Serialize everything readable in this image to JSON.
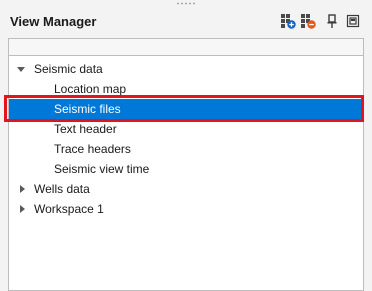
{
  "panel": {
    "title": "View Manager",
    "toolbar": [
      {
        "name": "add-view-icon"
      },
      {
        "name": "remove-view-icon"
      },
      {
        "name": "pin-icon"
      },
      {
        "name": "float-window-icon"
      }
    ]
  },
  "tree": {
    "seismic_data": {
      "label": "Seismic data",
      "expanded": true,
      "children": [
        "Location map",
        "Seismic files",
        "Text header",
        "Trace headers",
        "Seismic view time"
      ],
      "selected": "Seismic files"
    },
    "wells_data": {
      "label": "Wells data",
      "expanded": false
    },
    "workspace": {
      "label": "Workspace 1",
      "expanded": false
    }
  },
  "colors": {
    "selection": "#0078d7",
    "highlight_outline": "#e3141b",
    "accent_blue": "#1565c0",
    "accent_orange": "#e05a1c"
  }
}
